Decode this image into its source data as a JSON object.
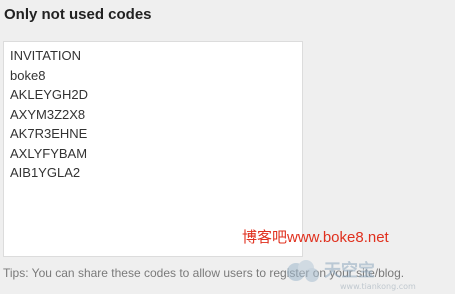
{
  "section": {
    "title": "Only not used codes"
  },
  "codes": [
    "INVITATION",
    "boke8",
    "AKLEYGH2D",
    "AXYM3Z2X8",
    "AK7R3EHNE",
    "AXLYFYBAM",
    "AIB1YGLA2"
  ],
  "watermark": {
    "text": "博客吧www.boke8.net",
    "logo_text": "天空宝",
    "logo_subtext": "www.tiankong.com",
    "color": "#e0301e"
  },
  "tips": "Tips: You can share these codes to allow users to register on your site/blog."
}
